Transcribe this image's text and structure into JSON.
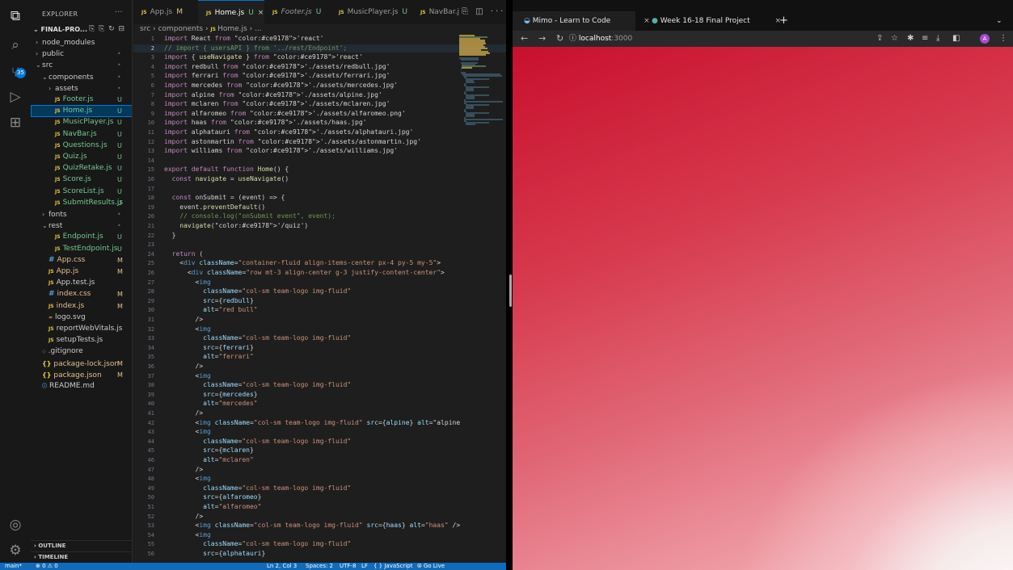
{
  "explorer": {
    "title": "EXPLORER",
    "more": "···",
    "project": "FINAL-PRO...",
    "project_icons": "⎘ ⎘ ↻ ⊟",
    "tree": [
      {
        "label": "node_modules",
        "indent": 1,
        "chevron": "›",
        "icon": "",
        "flag": "",
        "color": ""
      },
      {
        "label": "public",
        "indent": 1,
        "chevron": "›",
        "icon": "",
        "flag": "•",
        "color": ""
      },
      {
        "label": "src",
        "indent": 1,
        "chevron": "⌄",
        "icon": "",
        "flag": "•",
        "color": ""
      },
      {
        "label": "components",
        "indent": 2,
        "chevron": "⌄",
        "icon": "",
        "flag": "•",
        "color": ""
      },
      {
        "label": "assets",
        "indent": 3,
        "chevron": "›",
        "icon": "",
        "flag": "•",
        "color": ""
      },
      {
        "label": "Footer.js",
        "indent": 3,
        "chevron": "",
        "icon": "JS",
        "flag": "U",
        "color": "green"
      },
      {
        "label": "Home.js",
        "indent": 3,
        "chevron": "",
        "icon": "JS",
        "flag": "U",
        "color": "green",
        "selected": true
      },
      {
        "label": "MusicPlayer.js",
        "indent": 3,
        "chevron": "",
        "icon": "JS",
        "flag": "U",
        "color": "green"
      },
      {
        "label": "NavBar.js",
        "indent": 3,
        "chevron": "",
        "icon": "JS",
        "flag": "U",
        "color": "green"
      },
      {
        "label": "Questions.js",
        "indent": 3,
        "chevron": "",
        "icon": "JS",
        "flag": "U",
        "color": "green"
      },
      {
        "label": "Quiz.js",
        "indent": 3,
        "chevron": "",
        "icon": "JS",
        "flag": "U",
        "color": "green"
      },
      {
        "label": "QuizRetake.js",
        "indent": 3,
        "chevron": "",
        "icon": "JS",
        "flag": "U",
        "color": "green"
      },
      {
        "label": "Score.js",
        "indent": 3,
        "chevron": "",
        "icon": "JS",
        "flag": "U",
        "color": "green"
      },
      {
        "label": "ScoreList.js",
        "indent": 3,
        "chevron": "",
        "icon": "JS",
        "flag": "U",
        "color": "green"
      },
      {
        "label": "SubmitResults.js",
        "indent": 3,
        "chevron": "",
        "icon": "JS",
        "flag": "U",
        "color": "green"
      },
      {
        "label": "fonts",
        "indent": 2,
        "chevron": "›",
        "icon": "",
        "flag": "•",
        "color": ""
      },
      {
        "label": "rest",
        "indent": 2,
        "chevron": "⌄",
        "icon": "",
        "flag": "•",
        "color": ""
      },
      {
        "label": "Endpoint.js",
        "indent": 3,
        "chevron": "",
        "icon": "JS",
        "flag": "U",
        "color": "green"
      },
      {
        "label": "TestEndpoint.js",
        "indent": 3,
        "chevron": "",
        "icon": "JS",
        "flag": "U",
        "color": "green"
      },
      {
        "label": "App.css",
        "indent": 2,
        "chevron": "",
        "icon": "#",
        "flag": "M",
        "color": "yellow"
      },
      {
        "label": "App.js",
        "indent": 2,
        "chevron": "",
        "icon": "JS",
        "flag": "M",
        "color": "yellow"
      },
      {
        "label": "App.test.js",
        "indent": 2,
        "chevron": "",
        "icon": "JS",
        "flag": "",
        "color": ""
      },
      {
        "label": "index.css",
        "indent": 2,
        "chevron": "",
        "icon": "#",
        "flag": "M",
        "color": "yellow"
      },
      {
        "label": "index.js",
        "indent": 2,
        "chevron": "",
        "icon": "JS",
        "flag": "M",
        "color": "yellow"
      },
      {
        "label": "logo.svg",
        "indent": 2,
        "chevron": "",
        "icon": "≈",
        "flag": "",
        "color": ""
      },
      {
        "label": "reportWebVitals.js",
        "indent": 2,
        "chevron": "",
        "icon": "JS",
        "flag": "",
        "color": ""
      },
      {
        "label": "setupTests.js",
        "indent": 2,
        "chevron": "",
        "icon": "JS",
        "flag": "",
        "color": ""
      },
      {
        "label": ".gitignore",
        "indent": 1,
        "chevron": "",
        "icon": "◇",
        "flag": "",
        "color": ""
      },
      {
        "label": "package-lock.json",
        "indent": 1,
        "chevron": "",
        "icon": "{}",
        "flag": "M",
        "color": "yellow"
      },
      {
        "label": "package.json",
        "indent": 1,
        "chevron": "",
        "icon": "{}",
        "flag": "M",
        "color": "yellow"
      },
      {
        "label": "README.md",
        "indent": 1,
        "chevron": "",
        "icon": "ⓘ",
        "flag": "",
        "color": ""
      }
    ],
    "outline": "OUTLINE",
    "timeline": "TIMELINE"
  },
  "activity": {
    "badge": "35"
  },
  "editor": {
    "tabs": [
      {
        "label": "App.js",
        "flag": "M",
        "active": false,
        "italic": false
      },
      {
        "label": "Home.js",
        "flag": "U",
        "active": true,
        "italic": false,
        "close": "×"
      },
      {
        "label": "Footer.js",
        "flag": "U",
        "active": false,
        "italic": true
      },
      {
        "label": "MusicPlayer.js",
        "flag": "U",
        "active": false,
        "italic": false
      },
      {
        "label": "NavBar.j",
        "flag": "",
        "active": false,
        "italic": false
      }
    ],
    "tab_actions": "⎘ ◫ ···",
    "breadcrumb": [
      "src",
      "components",
      "Home.js",
      "..."
    ],
    "code": [
      "import React from 'react'",
      "// import { usersAPI } from '../rest/Endpoint';",
      "import { useNavigate } from 'react'",
      "import redbull from './assets/redbull.jpg'",
      "import ferrari from './assets/ferrari.jpg'",
      "import mercedes from './assets/mercedes.jpg'",
      "import alpine from './assets/alpine.jpg'",
      "import mclaren from './assets/mclaren.jpg'",
      "import alfaromeo from './assets/alfaromeo.png'",
      "import haas from './assets/haas.jpg'",
      "import alphatauri from './assets/alphatauri.jpg'",
      "import astonmartin from './assets/astonmartin.jpg'",
      "import williams from './assets/williams.jpg'",
      "",
      "export default function Home() {",
      "  const navigate = useNavigate()",
      "",
      "  const onSubmit = (event) => {",
      "    event.preventDefault()",
      "    // console.log(\"onSubmit event\", event);",
      "    navigate('/quiz')",
      "  }",
      "",
      "  return (",
      "    <div className=\"container-fluid align-items-center px-4 py-5 my-5\">",
      "      <div className=\"row mt-3 align-center g-3 justify-content-center\">",
      "        <img",
      "          className=\"col-sm team-logo img-fluid\"",
      "          src={redbull}",
      "          alt=\"red bull\"",
      "        />",
      "        <img",
      "          className=\"col-sm team-logo img-fluid\"",
      "          src={ferrari}",
      "          alt=\"ferrari\"",
      "        />",
      "        <img",
      "          className=\"col-sm team-logo img-fluid\"",
      "          src={mercedes}",
      "          alt=\"mercedes\"",
      "        />",
      "        <img className=\"col-sm team-logo img-fluid\" src={alpine} alt=\"alpine",
      "        <img",
      "          className=\"col-sm team-logo img-fluid\"",
      "          src={mclaren}",
      "          alt=\"mclaren\"",
      "        />",
      "        <img",
      "          className=\"col-sm team-logo img-fluid\"",
      "          src={alfaromeo}",
      "          alt=\"alfaromeo\"",
      "        />",
      "        <img className=\"col-sm team-logo img-fluid\" src={haas} alt=\"haas\" />",
      "        <img",
      "          className=\"col-sm team-logo img-fluid\"",
      "          src={alphatauri}"
    ],
    "current_line": 2
  },
  "status": {
    "branch": "main*",
    "sync": "⊗ 0 ⚠ 0",
    "cursor": "Ln 2, Col 3",
    "spaces": "Spaces: 2",
    "encoding": "UTF-8",
    "eol": "LF",
    "language": "{ } JavaScript",
    "golive": "⦾ Go Live"
  },
  "browser": {
    "tabs": [
      {
        "label": "Mimo - Learn to Code",
        "close": "×"
      },
      {
        "label": "Week 16-18 Final Project",
        "close": "×"
      }
    ],
    "new_tab": "+",
    "tab_menu": "⌄",
    "url_host": "localhost",
    "url_port": ":3000",
    "url_info": "ⓘ",
    "profile": "A",
    "colors": {
      "hero_top": "#c8102e",
      "hero_fade": "#f6eaea"
    }
  }
}
